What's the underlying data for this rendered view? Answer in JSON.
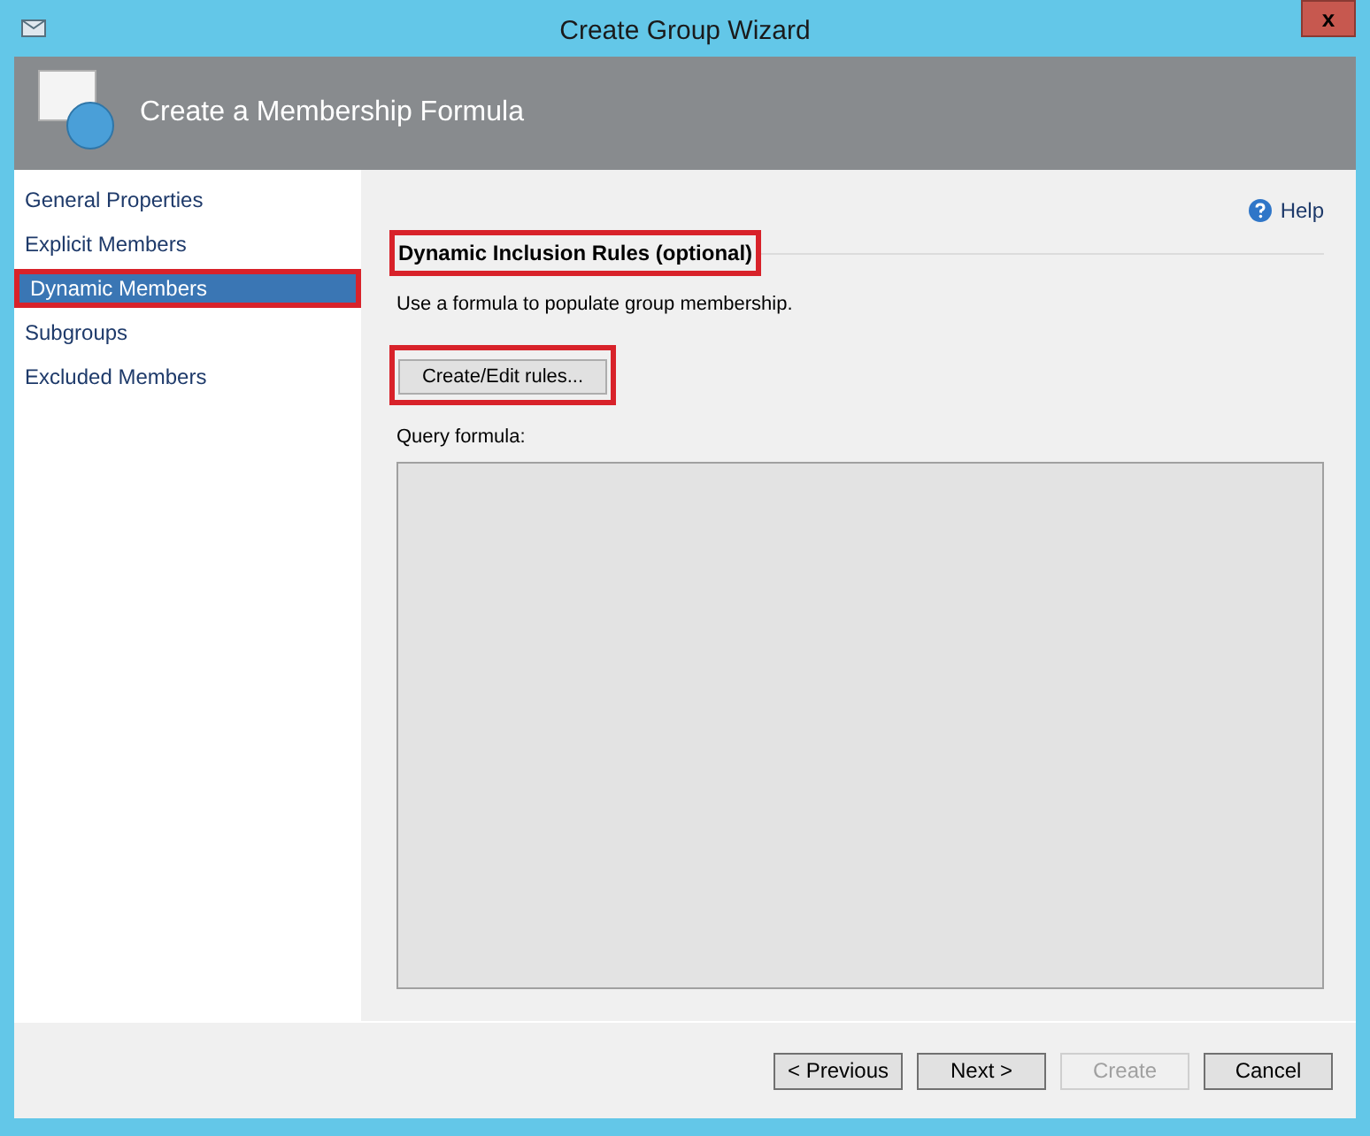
{
  "window": {
    "title": "Create Group Wizard",
    "close_glyph": "x"
  },
  "header": {
    "title": "Create a Membership Formula"
  },
  "sidebar": {
    "items": [
      {
        "label": "General Properties",
        "selected": false,
        "highlighted": false
      },
      {
        "label": "Explicit Members",
        "selected": false,
        "highlighted": false
      },
      {
        "label": "Dynamic Members",
        "selected": true,
        "highlighted": true
      },
      {
        "label": "Subgroups",
        "selected": false,
        "highlighted": false
      },
      {
        "label": "Excluded Members",
        "selected": false,
        "highlighted": false
      }
    ]
  },
  "content": {
    "help": "Help",
    "section_title": "Dynamic Inclusion Rules (optional)",
    "section_highlighted": true,
    "description": "Use a formula to populate group membership.",
    "rules_button": {
      "label": "Create/Edit rules...",
      "highlighted": true
    },
    "query_label": "Query formula:"
  },
  "footer": {
    "buttons": [
      {
        "label": "< Previous",
        "disabled": false
      },
      {
        "label": "Next >",
        "disabled": false
      },
      {
        "label": "Create",
        "disabled": true
      },
      {
        "label": "Cancel",
        "disabled": false
      }
    ]
  }
}
